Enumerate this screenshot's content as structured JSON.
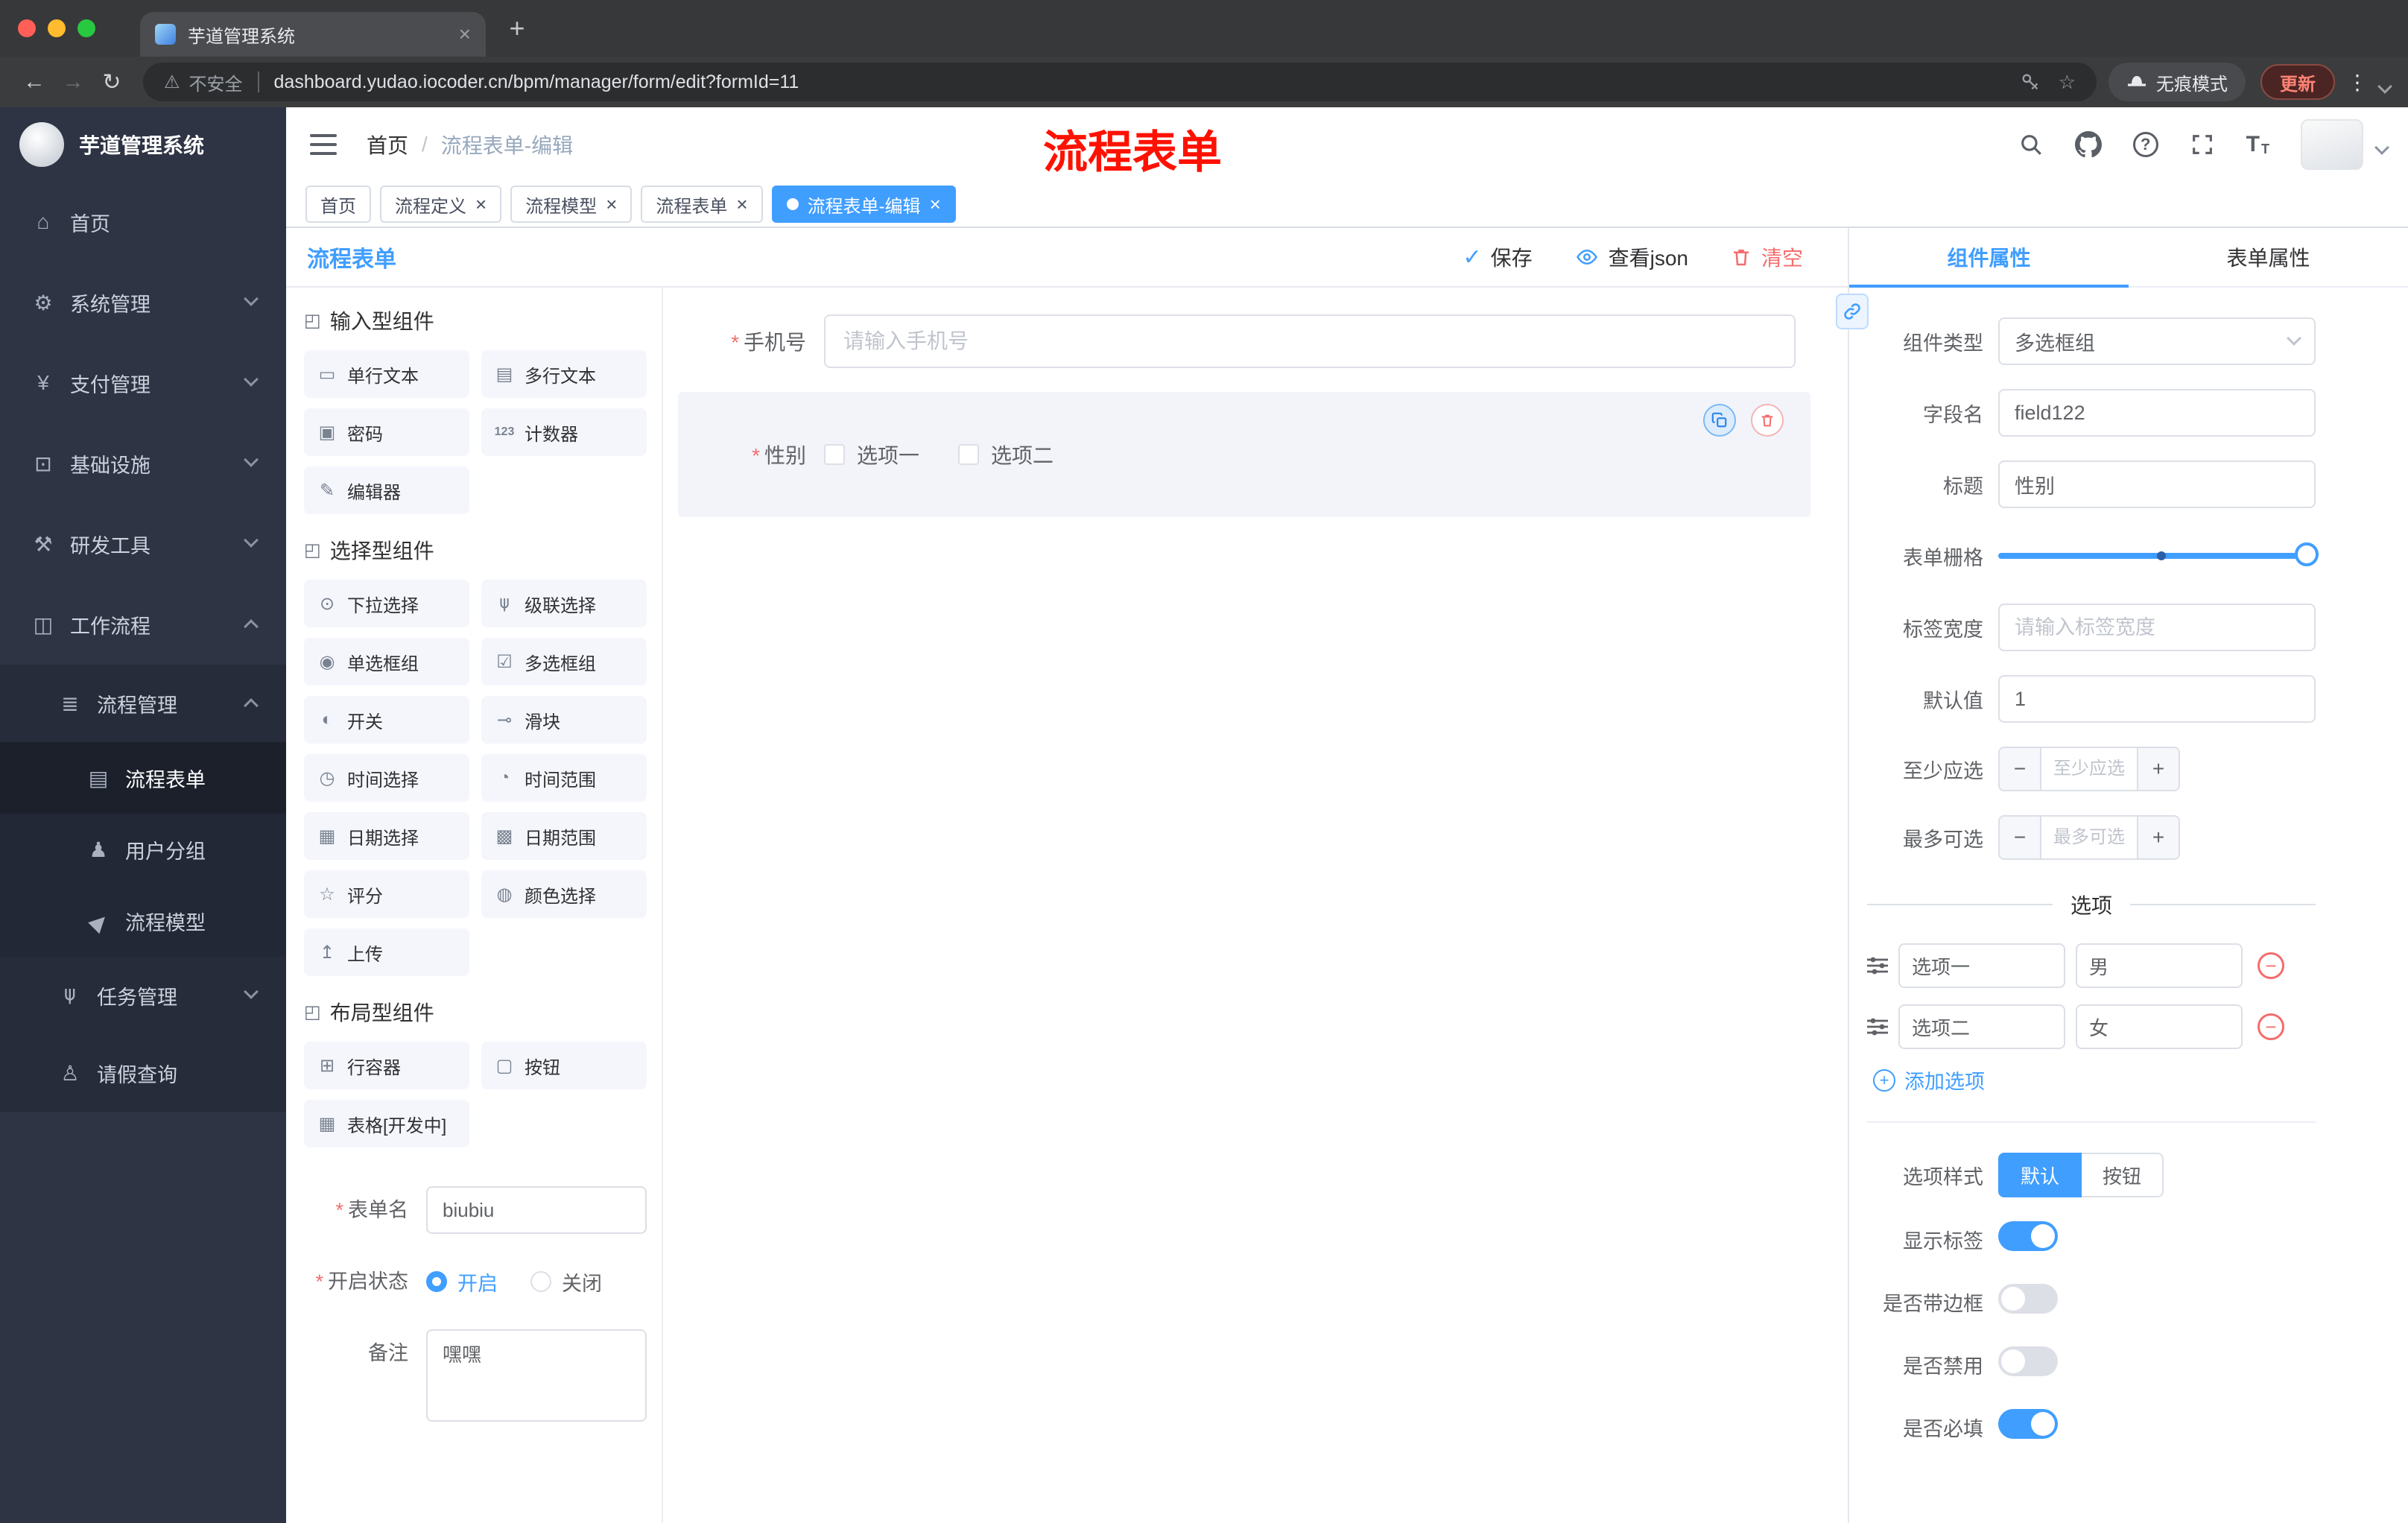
{
  "colors": {
    "accent": "#409eff",
    "danger": "#f56c6c",
    "annotation": "#fe1100",
    "sidebar_bg": "#2e3444"
  },
  "browser": {
    "tab_title": "芋道管理系统",
    "security_label": "不安全",
    "url": "dashboard.yudao.iocoder.cn/bpm/manager/form/edit?formId=11",
    "incognito_label": "无痕模式",
    "update_label": "更新"
  },
  "sidebar": {
    "logo_title": "芋道管理系统",
    "items": [
      {
        "label": "首页"
      },
      {
        "label": "系统管理"
      },
      {
        "label": "支付管理"
      },
      {
        "label": "基础设施"
      },
      {
        "label": "研发工具"
      },
      {
        "label": "工作流程"
      },
      {
        "label": "流程管理"
      },
      {
        "label": "流程表单"
      },
      {
        "label": "用户分组"
      },
      {
        "label": "流程模型"
      },
      {
        "label": "任务管理"
      },
      {
        "label": "请假查询"
      }
    ]
  },
  "header": {
    "breadcrumb_home": "首页",
    "breadcrumb_current": "流程表单-编辑",
    "annotation": "流程表单"
  },
  "route_tabs": [
    {
      "label": "首页"
    },
    {
      "label": "流程定义"
    },
    {
      "label": "流程模型"
    },
    {
      "label": "流程表单"
    },
    {
      "label": "流程表单-编辑"
    }
  ],
  "designer": {
    "panel_title": "流程表单",
    "save_label": "保存",
    "view_json_label": "查看json",
    "clear_label": "清空",
    "palette": {
      "sections": [
        {
          "title": "输入型组件",
          "items": [
            "单行文本",
            "多行文本",
            "密码",
            "计数器",
            "编辑器"
          ]
        },
        {
          "title": "选择型组件",
          "items": [
            "下拉选择",
            "级联选择",
            "单选框组",
            "多选框组",
            "开关",
            "滑块",
            "时间选择",
            "时间范围",
            "日期选择",
            "日期范围",
            "评分",
            "颜色选择",
            "上传"
          ]
        },
        {
          "title": "布局型组件",
          "items": [
            "行容器",
            "按钮",
            "表格[开发中]"
          ]
        }
      ]
    },
    "meta": {
      "name_label": "表单名",
      "name_value": "biubiu",
      "status_label": "开启状态",
      "status_on": "开启",
      "status_off": "关闭",
      "remark_label": "备注",
      "remark_value": "嘿嘿"
    },
    "canvas": {
      "phone_label": "手机号",
      "phone_placeholder": "请输入手机号",
      "gender_label": "性别",
      "gender_option1": "选项一",
      "gender_option2": "选项二"
    }
  },
  "props": {
    "tab_component": "组件属性",
    "tab_form": "表单属性",
    "component_type_label": "组件类型",
    "component_type_value": "多选框组",
    "field_name_label": "字段名",
    "field_name_value": "field122",
    "title_label": "标题",
    "title_value": "性别",
    "grid_label": "表单栅格",
    "label_width_label": "标签宽度",
    "label_width_placeholder": "请输入标签宽度",
    "default_label": "默认值",
    "default_value": "1",
    "min_label": "至少应选",
    "min_placeholder": "至少应选",
    "max_label": "最多可选",
    "max_placeholder": "最多可选",
    "options_title": "选项",
    "options": [
      {
        "label": "选项一",
        "value": "男"
      },
      {
        "label": "选项二",
        "value": "女"
      }
    ],
    "add_option_label": "添加选项",
    "option_style_label": "选项样式",
    "style_default": "默认",
    "style_button": "按钮",
    "toggle_show_label": "显示标签",
    "toggle_border": "是否带边框",
    "toggle_disabled": "是否禁用",
    "toggle_required": "是否必填"
  }
}
